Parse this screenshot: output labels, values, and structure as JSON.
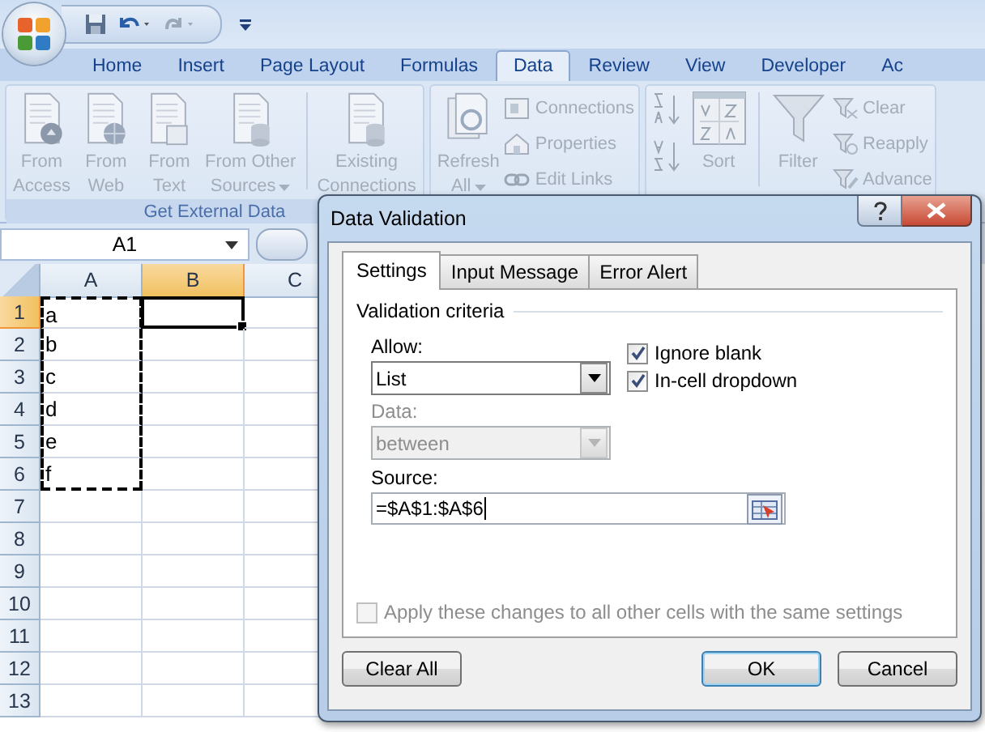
{
  "tabs": [
    {
      "label": "Home",
      "selected": false
    },
    {
      "label": "Insert",
      "selected": false
    },
    {
      "label": "Page Layout",
      "selected": false
    },
    {
      "label": "Formulas",
      "selected": false
    },
    {
      "label": "Data",
      "selected": true
    },
    {
      "label": "Review",
      "selected": false
    },
    {
      "label": "View",
      "selected": false
    },
    {
      "label": "Developer",
      "selected": false
    },
    {
      "label": "Ac",
      "selected": false
    }
  ],
  "ribbon": {
    "groups": [
      {
        "label": "Get External Data",
        "items": [
          {
            "kind": "large",
            "lines": [
              "From",
              "Access"
            ],
            "disabled": true
          },
          {
            "kind": "large",
            "lines": [
              "From",
              "Web"
            ],
            "disabled": true
          },
          {
            "kind": "large",
            "lines": [
              "From",
              "Text"
            ],
            "disabled": true
          },
          {
            "kind": "large",
            "lines": [
              "From Other",
              "Sources"
            ],
            "menu": true,
            "disabled": true
          },
          {
            "kind": "large",
            "lines": [
              "Existing",
              "Connections"
            ],
            "separator_before": true,
            "disabled": true
          }
        ]
      },
      {
        "items": [
          {
            "kind": "large",
            "lines": [
              "Refresh",
              "All"
            ],
            "menu": true,
            "disabled": true
          },
          {
            "kind": "small",
            "lines": [
              "Connections"
            ],
            "disabled": true
          },
          {
            "kind": "small",
            "lines": [
              "Properties"
            ],
            "disabled": true
          },
          {
            "kind": "small",
            "lines": [
              "Edit Links"
            ],
            "disabled": true
          }
        ]
      },
      {
        "items": [
          {
            "kind": "icon",
            "disabled": true
          },
          {
            "kind": "icon",
            "disabled": true
          },
          {
            "kind": "large",
            "lines": [
              "Sort"
            ],
            "disabled": true
          },
          {
            "kind": "large",
            "lines": [
              "Filter"
            ],
            "separator_before": true,
            "disabled": true
          },
          {
            "kind": "small",
            "lines": [
              "Clear"
            ],
            "disabled": true
          },
          {
            "kind": "small",
            "lines": [
              "Reapply"
            ],
            "disabled": true
          },
          {
            "kind": "small",
            "lines": [
              "Advance"
            ],
            "disabled": true
          }
        ]
      }
    ]
  },
  "name_box": {
    "value": "A1"
  },
  "sheet": {
    "columns": [
      {
        "label": "A",
        "selected": false
      },
      {
        "label": "B",
        "selected": true
      },
      {
        "label": "C",
        "selected": false
      }
    ],
    "rows": [
      {
        "label": "1",
        "selected": true,
        "cells": [
          {
            "value": "a",
            "copied": true,
            "active": false
          },
          {
            "copied": false,
            "active": true
          }
        ]
      },
      {
        "label": "2",
        "selected": false,
        "cells": [
          {
            "value": "b",
            "copied": true,
            "active": false
          },
          {
            "copied": false,
            "active": false
          }
        ]
      },
      {
        "label": "3",
        "selected": false,
        "cells": [
          {
            "value": "c",
            "copied": true,
            "active": false
          },
          {
            "copied": false,
            "active": false
          }
        ]
      },
      {
        "label": "4",
        "selected": false,
        "cells": [
          {
            "value": "d",
            "copied": true,
            "active": false
          },
          {
            "copied": false,
            "active": false
          }
        ]
      },
      {
        "label": "5",
        "selected": false,
        "cells": [
          {
            "value": "e",
            "copied": true,
            "active": false
          },
          {
            "copied": false,
            "active": false
          }
        ]
      },
      {
        "label": "6",
        "selected": false,
        "cells": [
          {
            "value": "f",
            "copied": true,
            "active": false
          },
          {
            "copied": false,
            "active": false
          }
        ]
      },
      {
        "label": "7",
        "selected": false,
        "cells": []
      },
      {
        "label": "8",
        "selected": false,
        "cells": []
      },
      {
        "label": "9",
        "selected": false,
        "cells": []
      },
      {
        "label": "10",
        "selected": false,
        "cells": []
      },
      {
        "label": "11",
        "selected": false,
        "cells": []
      },
      {
        "label": "12",
        "selected": false,
        "cells": []
      },
      {
        "label": "13",
        "selected": false,
        "cells": []
      }
    ]
  },
  "dialog": {
    "title": "Data Validation",
    "tabs": [
      {
        "label": "Settings",
        "selected": true
      },
      {
        "label": "Input Message",
        "selected": false
      },
      {
        "label": "Error Alert",
        "selected": false
      }
    ],
    "group_title": "Validation criteria",
    "allow": {
      "label": "Allow:",
      "value": "List",
      "disabled": false
    },
    "data": {
      "label": "Data:",
      "value": "between",
      "disabled": true
    },
    "checkboxes": [
      {
        "label": "Ignore blank",
        "checked": true,
        "disabled": false
      },
      {
        "label": "In-cell dropdown",
        "checked": true,
        "disabled": false
      }
    ],
    "source": {
      "label": "Source:",
      "value": "=$A$1:$A$6"
    },
    "apply_all": {
      "label": "Apply these changes to all other cells with the same settings",
      "checked": false,
      "disabled": true
    },
    "buttons": [
      {
        "label": "Clear All",
        "default": false
      },
      {
        "label": "OK",
        "default": true
      },
      {
        "label": "Cancel",
        "default": false
      }
    ]
  }
}
